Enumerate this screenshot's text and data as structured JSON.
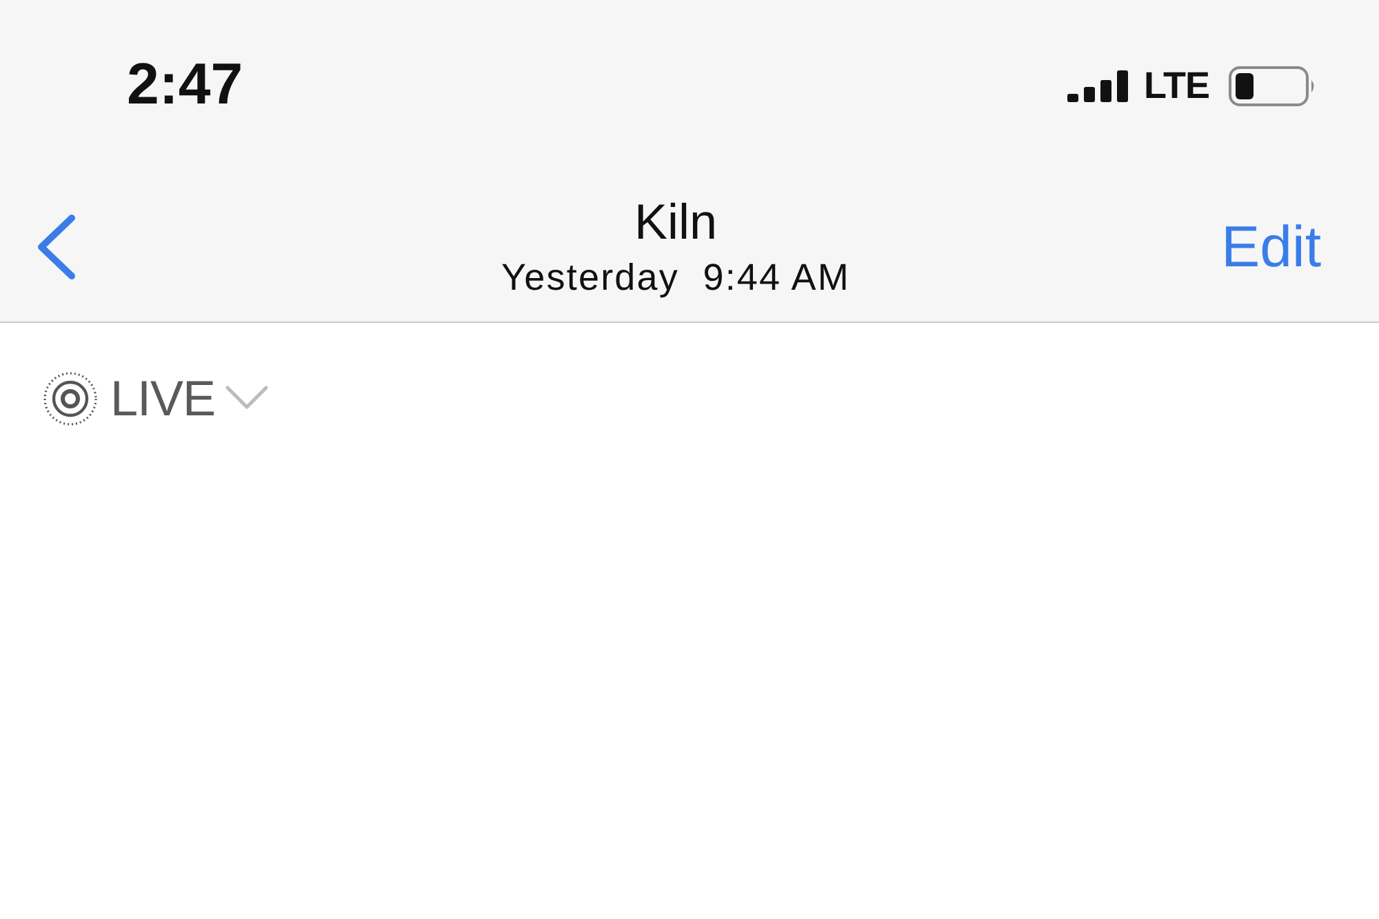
{
  "status_bar": {
    "time": "2:47",
    "network": "LTE"
  },
  "nav_bar": {
    "title": "Kiln",
    "subtitle": "Yesterday  9:44 AM",
    "edit_button": "Edit"
  },
  "live_button": {
    "label": "LIVE"
  }
}
